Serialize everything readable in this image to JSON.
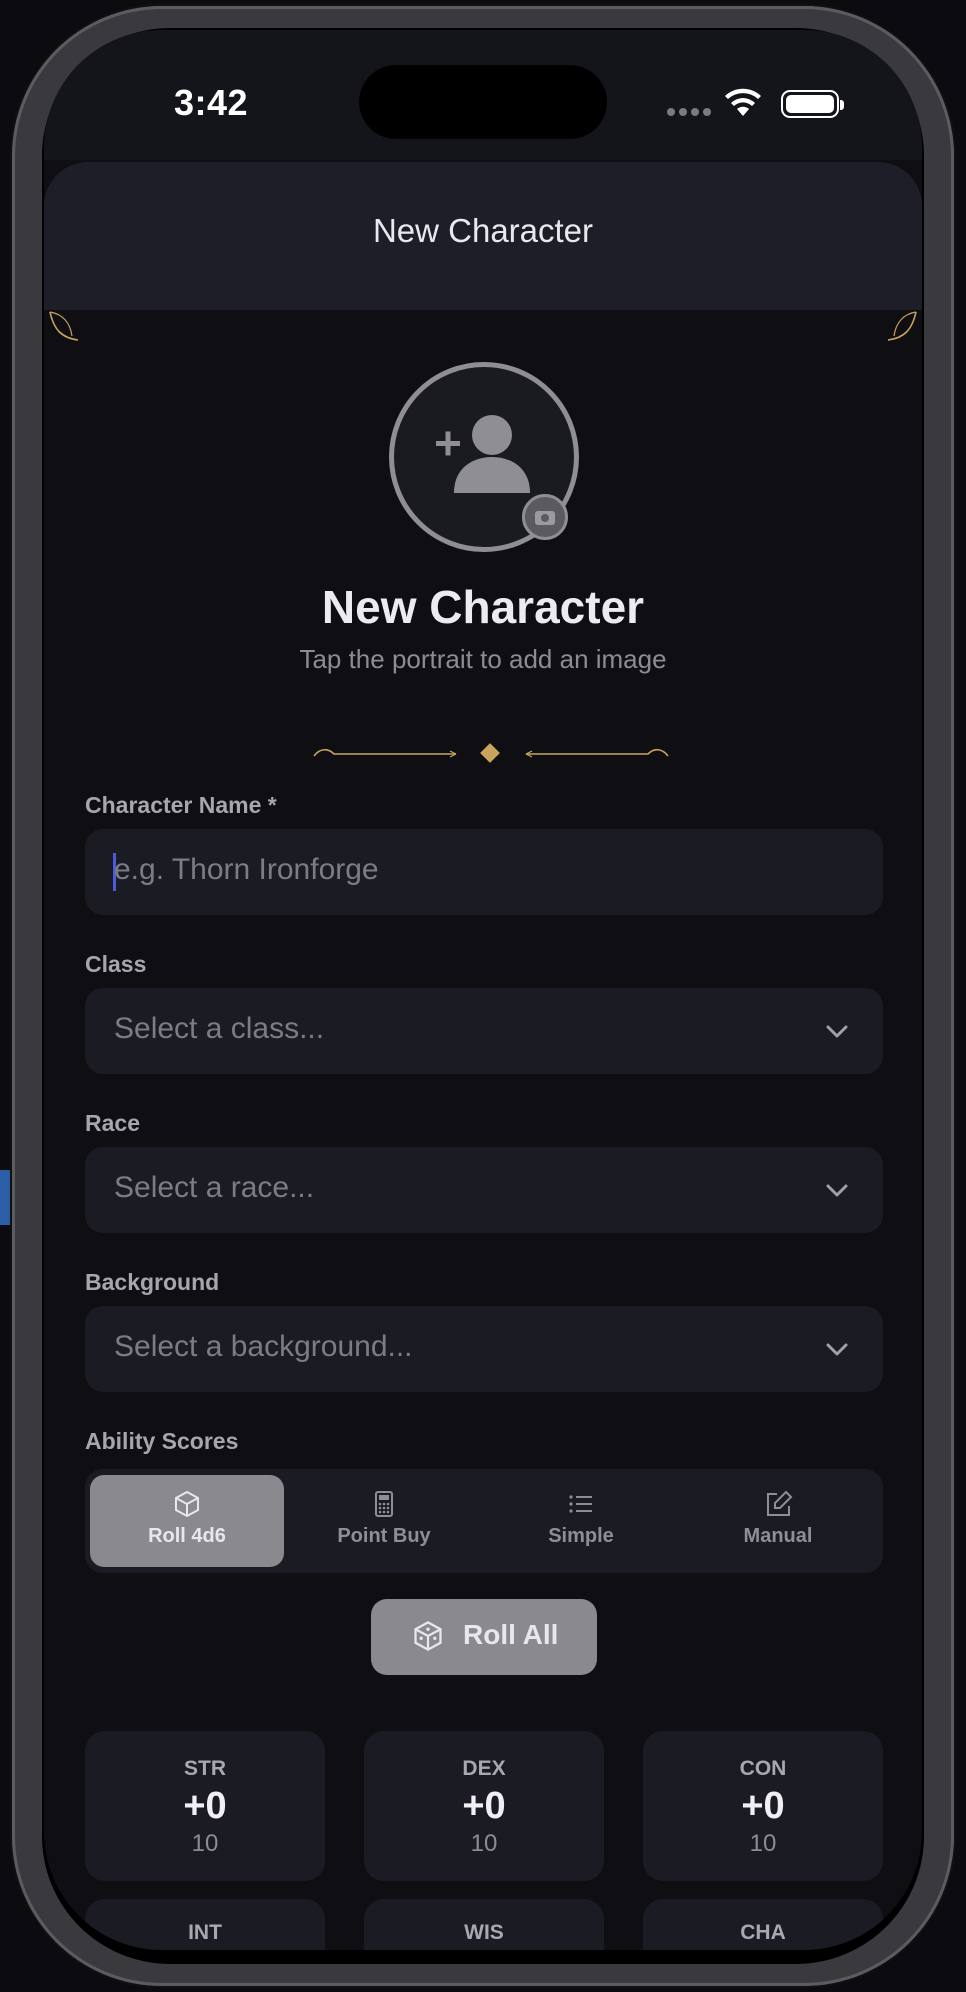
{
  "status_bar": {
    "time": "3:42"
  },
  "sheet": {
    "title": "New Character"
  },
  "portrait": {
    "title": "New Character",
    "subtitle": "Tap the portrait to add an image"
  },
  "form": {
    "name_label": "Character Name *",
    "name_placeholder": "e.g. Thorn Ironforge",
    "class_label": "Class",
    "class_value": "Select a class...",
    "race_label": "Race",
    "race_value": "Select a race...",
    "background_label": "Background",
    "background_value": "Select a background...",
    "ability_label": "Ability Scores"
  },
  "methods": [
    {
      "label": "Roll 4d6",
      "icon": "dice-icon",
      "active": true
    },
    {
      "label": "Point Buy",
      "icon": "calculator-icon",
      "active": false
    },
    {
      "label": "Simple",
      "icon": "list-icon",
      "active": false
    },
    {
      "label": "Manual",
      "icon": "edit-icon",
      "active": false
    }
  ],
  "roll_all": {
    "label": "Roll All"
  },
  "abilities": [
    {
      "name": "STR",
      "modifier": "+0",
      "score": "10"
    },
    {
      "name": "DEX",
      "modifier": "+0",
      "score": "10"
    },
    {
      "name": "CON",
      "modifier": "+0",
      "score": "10"
    },
    {
      "name": "INT"
    },
    {
      "name": "WIS"
    },
    {
      "name": "CHA"
    }
  ],
  "colors": {
    "accent": "#c9a55c",
    "cursor": "#4b5be0",
    "background": "#0e0e13",
    "field": "#1b1b24"
  }
}
